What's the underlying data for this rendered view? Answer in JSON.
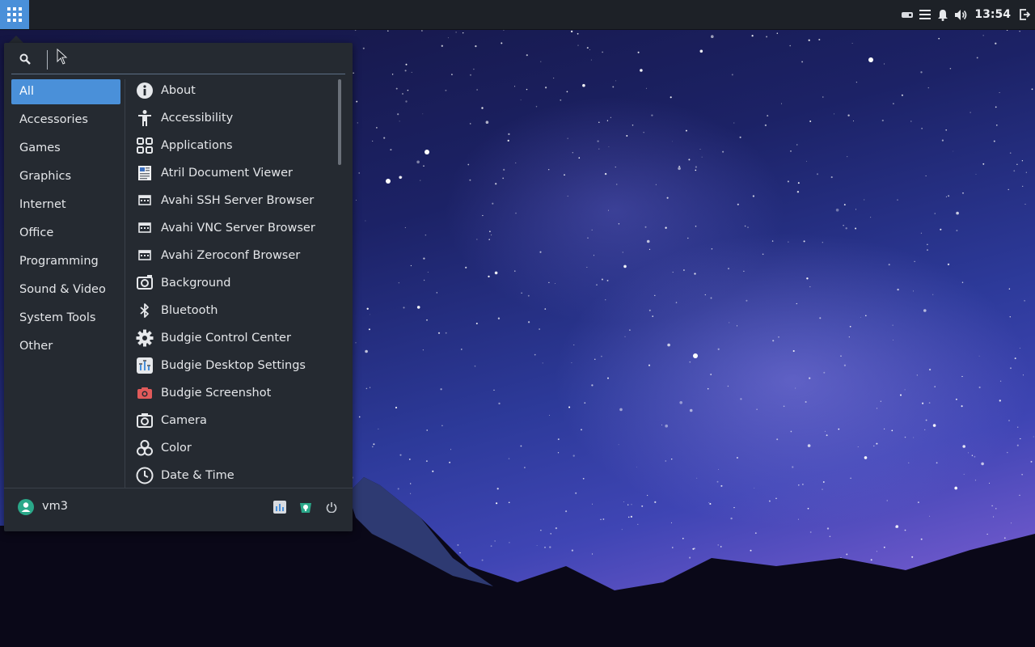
{
  "panel": {
    "clock": "13:54",
    "accent_color": "#4a90d9",
    "tray_icons": [
      "drive-icon",
      "notifications-list-icon",
      "bell-icon",
      "volume-icon"
    ],
    "end_icon": "logout-icon"
  },
  "menu": {
    "search": {
      "value": "",
      "placeholder": ""
    },
    "categories": [
      {
        "label": "All",
        "active": true
      },
      {
        "label": "Accessories"
      },
      {
        "label": "Games"
      },
      {
        "label": "Graphics"
      },
      {
        "label": "Internet"
      },
      {
        "label": "Office"
      },
      {
        "label": "Programming"
      },
      {
        "label": "Sound & Video"
      },
      {
        "label": "System Tools"
      },
      {
        "label": "Other"
      }
    ],
    "apps": [
      {
        "label": "About",
        "icon": "info-icon"
      },
      {
        "label": "Accessibility",
        "icon": "accessibility-icon"
      },
      {
        "label": "Applications",
        "icon": "applications-grid-icon"
      },
      {
        "label": "Atril Document Viewer",
        "icon": "document-viewer-icon"
      },
      {
        "label": "Avahi SSH Server Browser",
        "icon": "network-window-icon"
      },
      {
        "label": "Avahi VNC Server Browser",
        "icon": "network-window-icon"
      },
      {
        "label": "Avahi Zeroconf Browser",
        "icon": "network-window-icon"
      },
      {
        "label": "Background",
        "icon": "background-icon"
      },
      {
        "label": "Bluetooth",
        "icon": "bluetooth-icon"
      },
      {
        "label": "Budgie Control Center",
        "icon": "gear-icon"
      },
      {
        "label": "Budgie Desktop Settings",
        "icon": "desktop-settings-icon"
      },
      {
        "label": "Budgie Screenshot",
        "icon": "screenshot-camera-icon"
      },
      {
        "label": "Camera",
        "icon": "camera-icon"
      },
      {
        "label": "Color",
        "icon": "color-icon"
      },
      {
        "label": "Date & Time",
        "icon": "clock-icon"
      }
    ],
    "user": {
      "name": "vm3"
    },
    "footer_buttons": [
      "settings-icon",
      "software-icon",
      "power-icon"
    ]
  }
}
